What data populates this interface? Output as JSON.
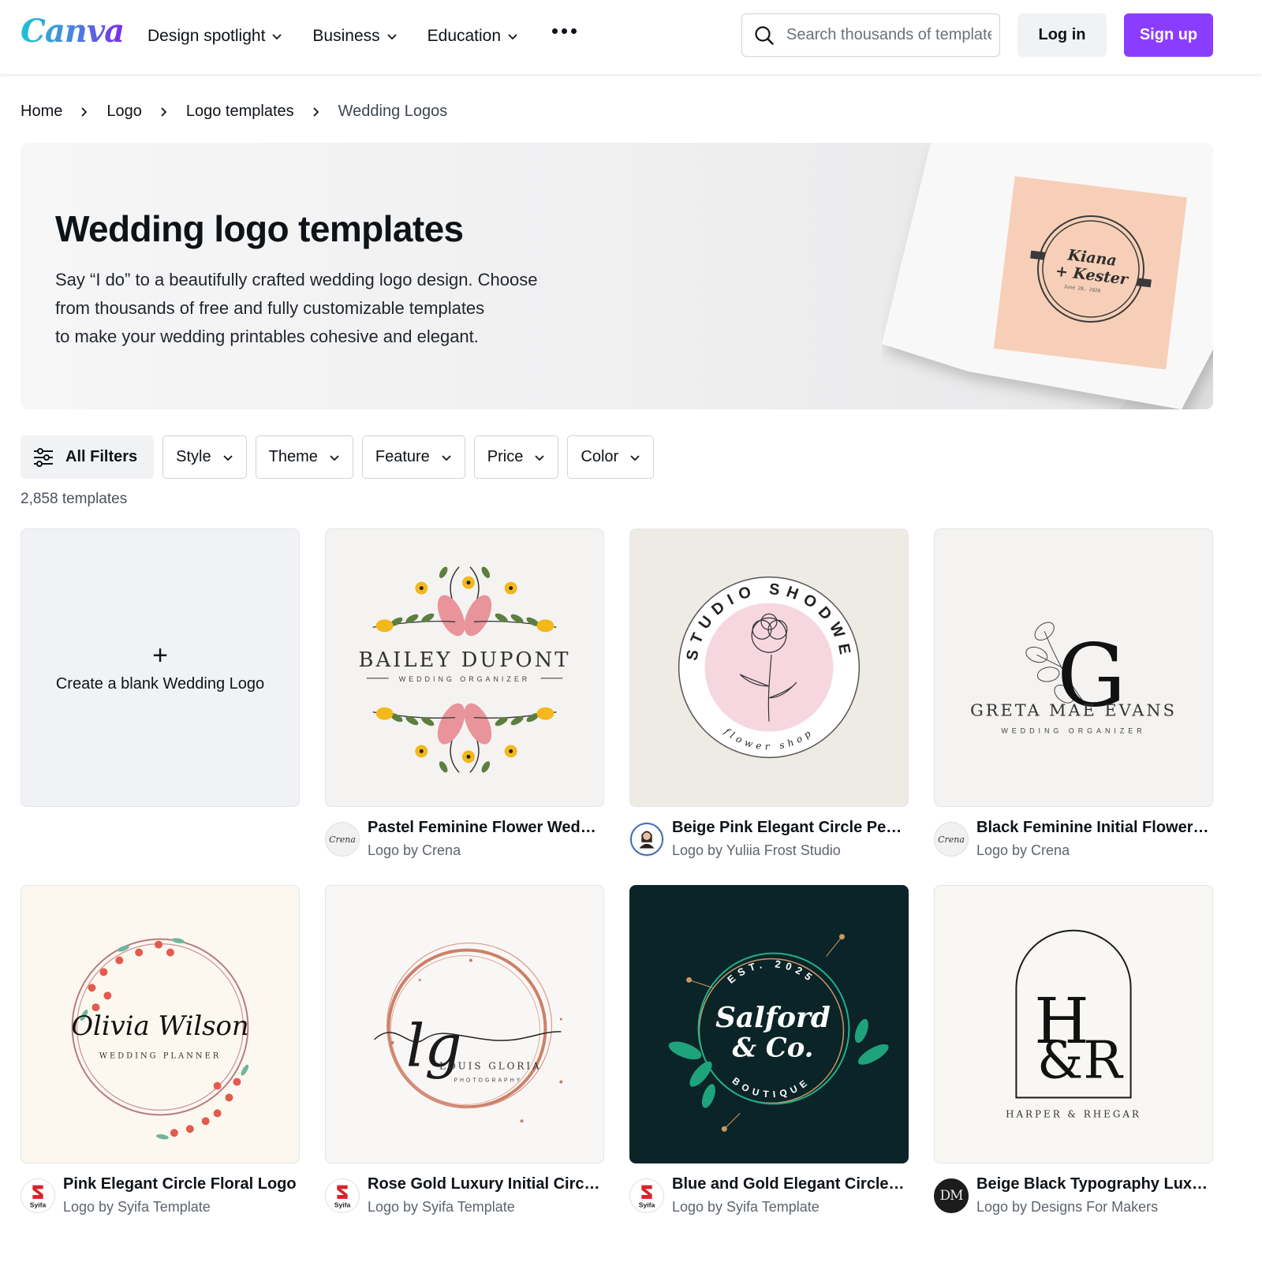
{
  "header": {
    "logo_text": "Canva",
    "nav": [
      {
        "label": "Design spotlight"
      },
      {
        "label": "Business"
      },
      {
        "label": "Education"
      }
    ],
    "more_icon": "more-horizontal-icon",
    "search": {
      "placeholder": "Search thousands of templates",
      "value": ""
    },
    "login_label": "Log in",
    "signup_label": "Sign up",
    "colors": {
      "brand_purple": "#8b3dff",
      "logo_cyan": "#1fc2d6"
    }
  },
  "breadcrumb": [
    {
      "label": "Home"
    },
    {
      "label": "Logo"
    },
    {
      "label": "Logo templates"
    },
    {
      "label": "Wedding Logos"
    }
  ],
  "hero": {
    "title": "Wedding logo templates",
    "description_lines": [
      "Say “I do” to a beautifully crafted wedding logo design. Choose",
      "from thousands of free and fully customizable templates",
      "to make your wedding printables cohesive and elegant."
    ],
    "art": {
      "name_line1": "Kiana",
      "name_line2": "+ Kester",
      "date": "June 28, 2020"
    }
  },
  "filters": {
    "all_label": "All Filters",
    "dropdowns": [
      {
        "label": "Style"
      },
      {
        "label": "Theme"
      },
      {
        "label": "Feature"
      },
      {
        "label": "Price"
      },
      {
        "label": "Color"
      }
    ]
  },
  "results": {
    "count_text": "2,858 templates"
  },
  "blank_card": {
    "plus": "+",
    "label": "Create a blank Wedding Logo"
  },
  "templates": [
    {
      "title": "Pastel Feminine Flower Weddi...",
      "author": "Logo by Crena",
      "avatar": "Crena",
      "art": {
        "line1": "BAILEY DUPONT",
        "line2": "WEDDING ORGANIZER"
      }
    },
    {
      "title": "Beige Pink Elegant Circle Peon...",
      "author": "Logo by Yuliia Frost Studio",
      "avatar": "",
      "art": {
        "line1": "STUDIO SHODWE",
        "line2": "flower shop"
      }
    },
    {
      "title": "Black Feminine Initial Flower L...",
      "author": "Logo by Crena",
      "avatar": "Crena",
      "art": {
        "initial": "G",
        "line1": "GRETA MAE EVANS",
        "line2": "WEDDING ORGANIZER"
      }
    },
    {
      "title": "Pink Elegant Circle Floral Logo",
      "author": "Logo by Syifa Template",
      "avatar": "Syifa",
      "art": {
        "line1": "Olivia Wilson",
        "line2": "WEDDING PLANNER"
      }
    },
    {
      "title": "Rose Gold Luxury Initial Circle ...",
      "author": "Logo by Syifa Template",
      "avatar": "Syifa",
      "art": {
        "initial": "lg",
        "line1": "LOUIS GLORIA",
        "line2": "PHOTOGRAPHY"
      }
    },
    {
      "title": "Blue and Gold Elegant Circle F...",
      "author": "Logo by Syifa Template",
      "avatar": "Syifa",
      "art": {
        "top": "EST. 2025",
        "line1": "Salford",
        "line2": "& Co.",
        "bottom": "BOUTIQUE"
      }
    },
    {
      "title": "Beige Black Typography Luxur...",
      "author": "Logo by Designs For Makers",
      "avatar": "DM",
      "art": {
        "initial1": "H",
        "initial2": "&R",
        "line1": "HARPER & RHEGAR"
      }
    }
  ]
}
